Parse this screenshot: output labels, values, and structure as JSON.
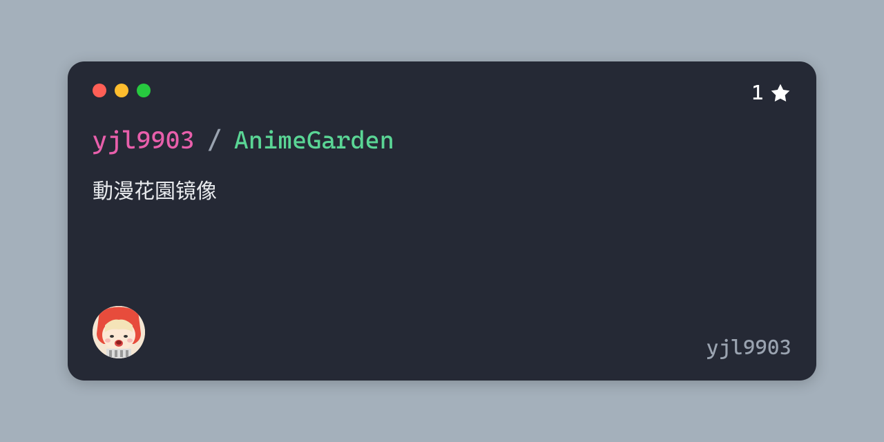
{
  "card": {
    "owner": "yjl9903",
    "separator": "/",
    "repo": "AnimeGarden",
    "description": "動漫花園镜像",
    "stars": "1",
    "username": "yjl9903"
  }
}
